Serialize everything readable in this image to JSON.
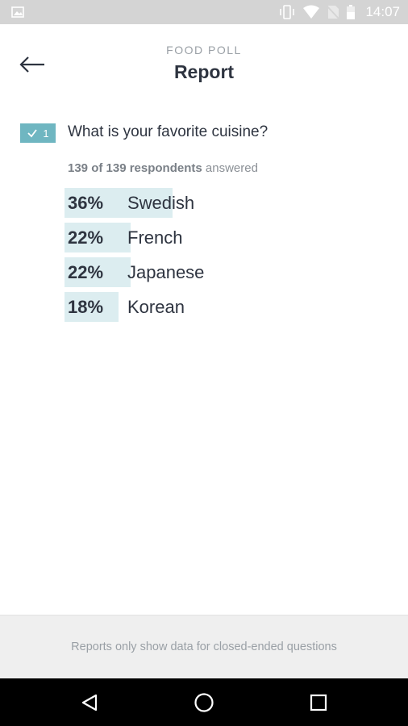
{
  "status_bar": {
    "time": "14:07",
    "icons": [
      "gallery-icon",
      "vibrate-icon",
      "wifi-icon",
      "no-sim-icon",
      "battery-icon"
    ]
  },
  "header": {
    "subtitle": "FOOD POLL",
    "title": "Report",
    "back_icon": "arrow-left-icon"
  },
  "question": {
    "number": "1",
    "badge_icon": "checkmark-icon",
    "text": "What is your favorite cuisine?",
    "respondents_count": "139 of 139 respondents",
    "respondents_suffix": "answered",
    "options": [
      {
        "percent": "36%",
        "label": "Swedish",
        "value": 36
      },
      {
        "percent": "22%",
        "label": "French",
        "value": 22
      },
      {
        "percent": "22%",
        "label": "Japanese",
        "value": 22
      },
      {
        "percent": "18%",
        "label": "Korean",
        "value": 18
      }
    ]
  },
  "footer_note": "Reports only show data for closed-ended questions",
  "nav_bar": {
    "back_icon": "triangle-back-icon",
    "home_icon": "circle-home-icon",
    "recents_icon": "square-recents-icon"
  },
  "colors": {
    "accent": "#6fb6c1",
    "bar_fill": "#dcedf0",
    "text": "#2e3440",
    "muted": "#9aa0a6"
  }
}
